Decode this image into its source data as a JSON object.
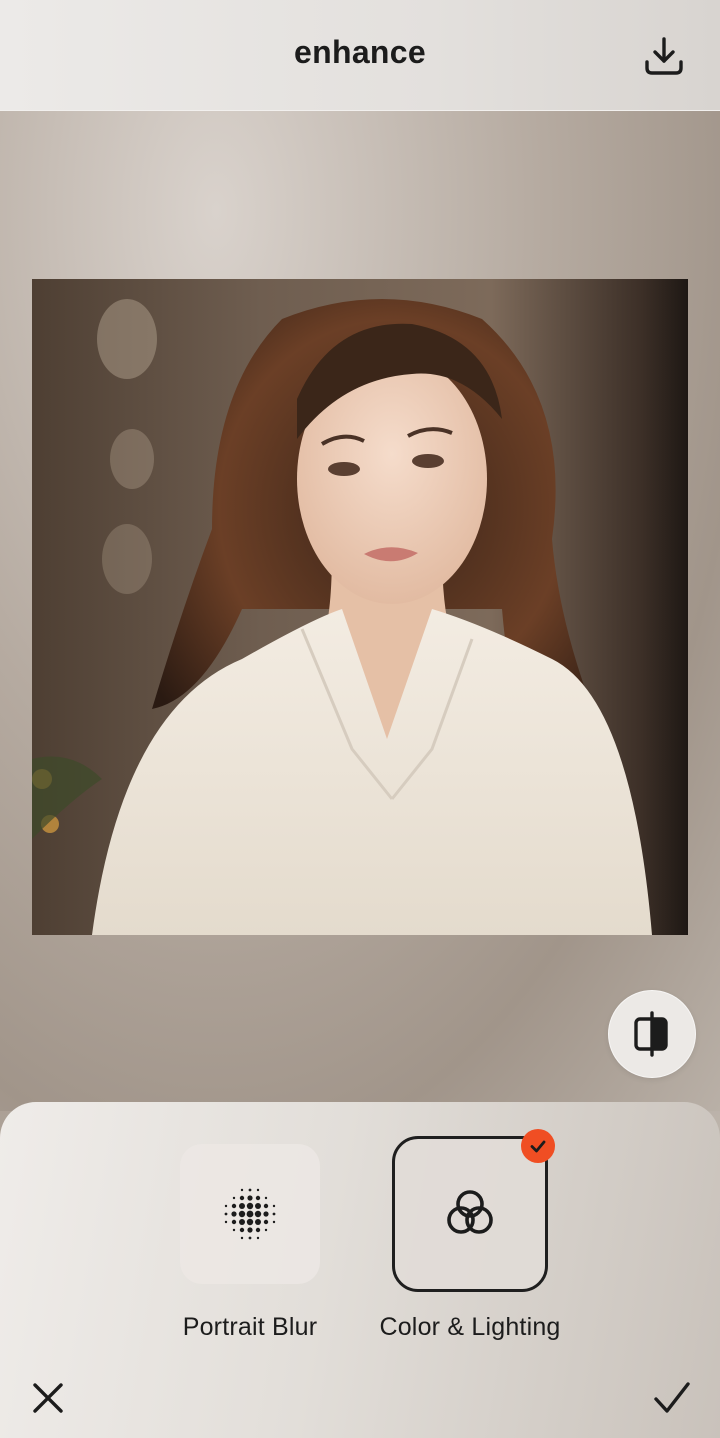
{
  "header": {
    "title": "enhance",
    "download_icon": "download-icon"
  },
  "photo": {
    "subject": "portrait-photo"
  },
  "compare": {
    "icon": "compare-split-icon"
  },
  "tools": [
    {
      "label": "Portrait Blur",
      "icon": "dot-grid-icon",
      "selected": false
    },
    {
      "label": "Color & Lighting",
      "icon": "interlocking-circles-icon",
      "selected": true
    }
  ],
  "footer": {
    "cancel_icon": "close-icon",
    "confirm_icon": "checkmark-icon"
  },
  "colors": {
    "accent": "#f04e23",
    "text": "#1c1c1c"
  }
}
